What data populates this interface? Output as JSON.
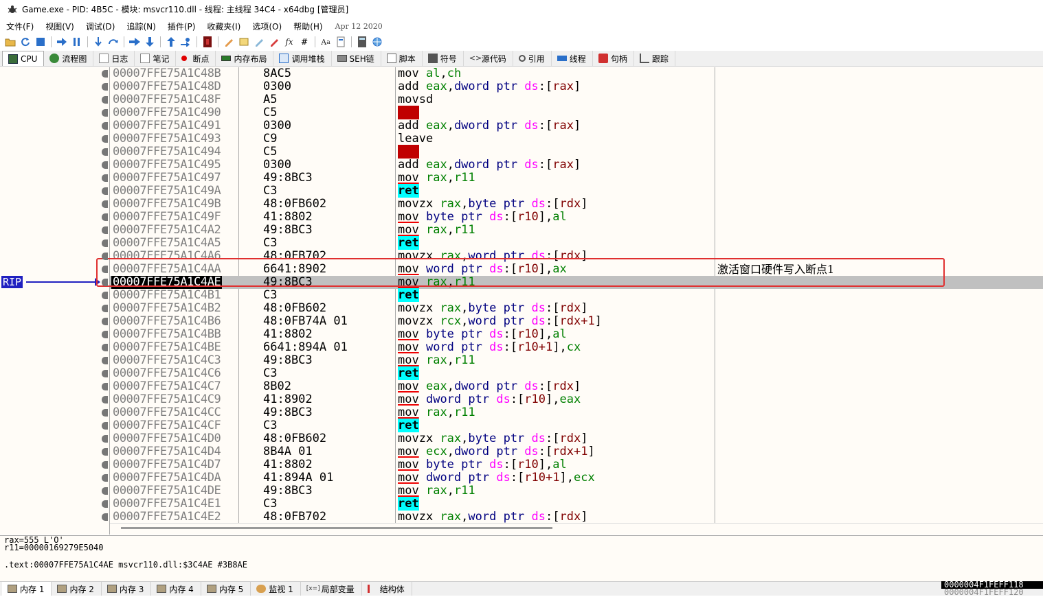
{
  "title": "Game.exe - PID: 4B5C - 模块: msvcr110.dll - 线程: 主线程 34C4 - x64dbg [管理员]",
  "menu": {
    "items": [
      "文件(F)",
      "视图(V)",
      "调试(D)",
      "追踪(N)",
      "插件(P)",
      "收藏夹(I)",
      "选项(O)",
      "帮助(H)"
    ],
    "date": "Apr 12 2020"
  },
  "tabs": [
    {
      "label": "CPU",
      "icon": "cpu-icon"
    },
    {
      "label": "流程图",
      "icon": "graph-icon"
    },
    {
      "label": "日志",
      "icon": "log-icon"
    },
    {
      "label": "笔记",
      "icon": "notes-icon"
    },
    {
      "label": "断点",
      "icon": "breakpoint-icon"
    },
    {
      "label": "内存布局",
      "icon": "memory-map-icon"
    },
    {
      "label": "调用堆栈",
      "icon": "call-stack-icon"
    },
    {
      "label": "SEH链",
      "icon": "seh-icon"
    },
    {
      "label": "脚本",
      "icon": "script-icon"
    },
    {
      "label": "符号",
      "icon": "symbol-icon"
    },
    {
      "label": "源代码",
      "icon": "source-icon"
    },
    {
      "label": "引用",
      "icon": "references-icon"
    },
    {
      "label": "线程",
      "icon": "threads-icon"
    },
    {
      "label": "句柄",
      "icon": "handles-icon"
    },
    {
      "label": "跟踪",
      "icon": "trace-icon"
    }
  ],
  "rip_label": "RIP",
  "disasm": [
    {
      "addr": "00007FFE75A1C48B",
      "bytes": "8AC5",
      "tokens": [
        [
          "mn",
          "mov"
        ],
        [
          "t",
          " "
        ],
        [
          "reg",
          "al"
        ],
        [
          "br",
          ","
        ],
        [
          "reg",
          "ch"
        ]
      ]
    },
    {
      "addr": "00007FFE75A1C48D",
      "bytes": "0300",
      "tokens": [
        [
          "mn",
          "add"
        ],
        [
          "t",
          " "
        ],
        [
          "reg",
          "eax"
        ],
        [
          "br",
          ","
        ],
        [
          "sz",
          "dword ptr "
        ],
        [
          "seg",
          "ds"
        ],
        [
          "br",
          ":["
        ],
        [
          "num",
          "rax"
        ],
        [
          "br",
          "]"
        ]
      ]
    },
    {
      "addr": "00007FFE75A1C48F",
      "bytes": "A5",
      "tokens": [
        [
          "mn",
          "movsd"
        ]
      ]
    },
    {
      "addr": "00007FFE75A1C490",
      "bytes": "C5",
      "tokens": [
        [
          "bad",
          "???"
        ]
      ]
    },
    {
      "addr": "00007FFE75A1C491",
      "bytes": "0300",
      "tokens": [
        [
          "mn",
          "add"
        ],
        [
          "t",
          " "
        ],
        [
          "reg",
          "eax"
        ],
        [
          "br",
          ","
        ],
        [
          "sz",
          "dword ptr "
        ],
        [
          "seg",
          "ds"
        ],
        [
          "br",
          ":["
        ],
        [
          "num",
          "rax"
        ],
        [
          "br",
          "]"
        ]
      ]
    },
    {
      "addr": "00007FFE75A1C493",
      "bytes": "C9",
      "tokens": [
        [
          "mn",
          "leave"
        ]
      ]
    },
    {
      "addr": "00007FFE75A1C494",
      "bytes": "C5",
      "tokens": [
        [
          "bad",
          "???"
        ]
      ]
    },
    {
      "addr": "00007FFE75A1C495",
      "bytes": "0300",
      "tokens": [
        [
          "mn",
          "add"
        ],
        [
          "t",
          " "
        ],
        [
          "reg",
          "eax"
        ],
        [
          "br",
          ","
        ],
        [
          "sz",
          "dword ptr "
        ],
        [
          "seg",
          "ds"
        ],
        [
          "br",
          ":["
        ],
        [
          "num",
          "rax"
        ],
        [
          "br",
          "]"
        ]
      ]
    },
    {
      "addr": "00007FFE75A1C497",
      "bytes": "49:8BC3",
      "tokens": [
        [
          "mnu",
          "mov"
        ],
        [
          "t",
          " "
        ],
        [
          "reg",
          "rax"
        ],
        [
          "br",
          ","
        ],
        [
          "reg",
          "r11"
        ]
      ]
    },
    {
      "addr": "00007FFE75A1C49A",
      "bytes": "C3",
      "tokens": [
        [
          "ret",
          "ret"
        ]
      ]
    },
    {
      "addr": "00007FFE75A1C49B",
      "bytes": "48:0FB602",
      "tokens": [
        [
          "mn",
          "movzx"
        ],
        [
          "t",
          " "
        ],
        [
          "reg",
          "rax"
        ],
        [
          "br",
          ","
        ],
        [
          "sz",
          "byte ptr "
        ],
        [
          "seg",
          "ds"
        ],
        [
          "br",
          ":["
        ],
        [
          "num",
          "rdx"
        ],
        [
          "br",
          "]"
        ]
      ]
    },
    {
      "addr": "00007FFE75A1C49F",
      "bytes": "41:8802",
      "tokens": [
        [
          "mnu",
          "mov"
        ],
        [
          "t",
          " "
        ],
        [
          "sz",
          "byte ptr "
        ],
        [
          "seg",
          "ds"
        ],
        [
          "br",
          ":["
        ],
        [
          "num",
          "r10"
        ],
        [
          "br",
          "]"
        ],
        [
          "br",
          ","
        ],
        [
          "reg",
          "al"
        ]
      ]
    },
    {
      "addr": "00007FFE75A1C4A2",
      "bytes": "49:8BC3",
      "tokens": [
        [
          "mnu",
          "mov"
        ],
        [
          "t",
          " "
        ],
        [
          "reg",
          "rax"
        ],
        [
          "br",
          ","
        ],
        [
          "reg",
          "r11"
        ]
      ]
    },
    {
      "addr": "00007FFE75A1C4A5",
      "bytes": "C3",
      "tokens": [
        [
          "ret",
          "ret"
        ]
      ]
    },
    {
      "addr": "00007FFE75A1C4A6",
      "bytes": "48:0FB702",
      "tokens": [
        [
          "mn",
          "movzx"
        ],
        [
          "t",
          " "
        ],
        [
          "reg",
          "rax"
        ],
        [
          "br",
          ","
        ],
        [
          "sz",
          "word ptr "
        ],
        [
          "seg",
          "ds"
        ],
        [
          "br",
          ":["
        ],
        [
          "num",
          "rdx"
        ],
        [
          "br",
          "]"
        ]
      ]
    },
    {
      "addr": "00007FFE75A1C4AA",
      "bytes": "6641:8902",
      "tokens": [
        [
          "mnu",
          "mov"
        ],
        [
          "t",
          " "
        ],
        [
          "sz",
          "word ptr "
        ],
        [
          "seg",
          "ds"
        ],
        [
          "br",
          ":["
        ],
        [
          "num",
          "r10"
        ],
        [
          "br",
          "]"
        ],
        [
          "br",
          ","
        ],
        [
          "reg",
          "ax"
        ]
      ],
      "comment": "激活窗口硬件写入断点1"
    },
    {
      "addr": "00007FFE75A1C4AE",
      "bytes": "49:8BC3",
      "tokens": [
        [
          "mnu",
          "mov"
        ],
        [
          "t",
          " "
        ],
        [
          "reg",
          "rax"
        ],
        [
          "br",
          ","
        ],
        [
          "reg",
          "r11"
        ]
      ],
      "selected": true
    },
    {
      "addr": "00007FFE75A1C4B1",
      "bytes": "C3",
      "tokens": [
        [
          "ret",
          "ret"
        ]
      ]
    },
    {
      "addr": "00007FFE75A1C4B2",
      "bytes": "48:0FB602",
      "tokens": [
        [
          "mn",
          "movzx"
        ],
        [
          "t",
          " "
        ],
        [
          "reg",
          "rax"
        ],
        [
          "br",
          ","
        ],
        [
          "sz",
          "byte ptr "
        ],
        [
          "seg",
          "ds"
        ],
        [
          "br",
          ":["
        ],
        [
          "num",
          "rdx"
        ],
        [
          "br",
          "]"
        ]
      ]
    },
    {
      "addr": "00007FFE75A1C4B6",
      "bytes": "48:0FB74A 01",
      "tokens": [
        [
          "mn",
          "movzx"
        ],
        [
          "t",
          " "
        ],
        [
          "reg",
          "rcx"
        ],
        [
          "br",
          ","
        ],
        [
          "sz",
          "word ptr "
        ],
        [
          "seg",
          "ds"
        ],
        [
          "br",
          ":["
        ],
        [
          "num",
          "rdx"
        ],
        [
          "plus",
          "+1"
        ],
        [
          "br",
          "]"
        ]
      ]
    },
    {
      "addr": "00007FFE75A1C4BB",
      "bytes": "41:8802",
      "tokens": [
        [
          "mnu",
          "mov"
        ],
        [
          "t",
          " "
        ],
        [
          "sz",
          "byte ptr "
        ],
        [
          "seg",
          "ds"
        ],
        [
          "br",
          ":["
        ],
        [
          "num",
          "r10"
        ],
        [
          "br",
          "]"
        ],
        [
          "br",
          ","
        ],
        [
          "reg",
          "al"
        ]
      ]
    },
    {
      "addr": "00007FFE75A1C4BE",
      "bytes": "6641:894A 01",
      "tokens": [
        [
          "mnu",
          "mov"
        ],
        [
          "t",
          " "
        ],
        [
          "sz",
          "word ptr "
        ],
        [
          "seg",
          "ds"
        ],
        [
          "br",
          ":["
        ],
        [
          "num",
          "r10"
        ],
        [
          "plus",
          "+1"
        ],
        [
          "br",
          "]"
        ],
        [
          "br",
          ","
        ],
        [
          "reg",
          "cx"
        ]
      ]
    },
    {
      "addr": "00007FFE75A1C4C3",
      "bytes": "49:8BC3",
      "tokens": [
        [
          "mnu",
          "mov"
        ],
        [
          "t",
          " "
        ],
        [
          "reg",
          "rax"
        ],
        [
          "br",
          ","
        ],
        [
          "reg",
          "r11"
        ]
      ]
    },
    {
      "addr": "00007FFE75A1C4C6",
      "bytes": "C3",
      "tokens": [
        [
          "ret",
          "ret"
        ]
      ]
    },
    {
      "addr": "00007FFE75A1C4C7",
      "bytes": "8B02",
      "tokens": [
        [
          "mnu",
          "mov"
        ],
        [
          "t",
          " "
        ],
        [
          "reg",
          "eax"
        ],
        [
          "br",
          ","
        ],
        [
          "sz",
          "dword ptr "
        ],
        [
          "seg",
          "ds"
        ],
        [
          "br",
          ":["
        ],
        [
          "num",
          "rdx"
        ],
        [
          "br",
          "]"
        ]
      ]
    },
    {
      "addr": "00007FFE75A1C4C9",
      "bytes": "41:8902",
      "tokens": [
        [
          "mnu",
          "mov"
        ],
        [
          "t",
          " "
        ],
        [
          "sz",
          "dword ptr "
        ],
        [
          "seg",
          "ds"
        ],
        [
          "br",
          ":["
        ],
        [
          "num",
          "r10"
        ],
        [
          "br",
          "]"
        ],
        [
          "br",
          ","
        ],
        [
          "reg",
          "eax"
        ]
      ]
    },
    {
      "addr": "00007FFE75A1C4CC",
      "bytes": "49:8BC3",
      "tokens": [
        [
          "mnu",
          "mov"
        ],
        [
          "t",
          " "
        ],
        [
          "reg",
          "rax"
        ],
        [
          "br",
          ","
        ],
        [
          "reg",
          "r11"
        ]
      ]
    },
    {
      "addr": "00007FFE75A1C4CF",
      "bytes": "C3",
      "tokens": [
        [
          "ret",
          "ret"
        ]
      ]
    },
    {
      "addr": "00007FFE75A1C4D0",
      "bytes": "48:0FB602",
      "tokens": [
        [
          "mn",
          "movzx"
        ],
        [
          "t",
          " "
        ],
        [
          "reg",
          "rax"
        ],
        [
          "br",
          ","
        ],
        [
          "sz",
          "byte ptr "
        ],
        [
          "seg",
          "ds"
        ],
        [
          "br",
          ":["
        ],
        [
          "num",
          "rdx"
        ],
        [
          "br",
          "]"
        ]
      ]
    },
    {
      "addr": "00007FFE75A1C4D4",
      "bytes": "8B4A 01",
      "tokens": [
        [
          "mnu",
          "mov"
        ],
        [
          "t",
          " "
        ],
        [
          "reg",
          "ecx"
        ],
        [
          "br",
          ","
        ],
        [
          "sz",
          "dword ptr "
        ],
        [
          "seg",
          "ds"
        ],
        [
          "br",
          ":["
        ],
        [
          "num",
          "rdx"
        ],
        [
          "plus",
          "+1"
        ],
        [
          "br",
          "]"
        ]
      ]
    },
    {
      "addr": "00007FFE75A1C4D7",
      "bytes": "41:8802",
      "tokens": [
        [
          "mnu",
          "mov"
        ],
        [
          "t",
          " "
        ],
        [
          "sz",
          "byte ptr "
        ],
        [
          "seg",
          "ds"
        ],
        [
          "br",
          ":["
        ],
        [
          "num",
          "r10"
        ],
        [
          "br",
          "]"
        ],
        [
          "br",
          ","
        ],
        [
          "reg",
          "al"
        ]
      ]
    },
    {
      "addr": "00007FFE75A1C4DA",
      "bytes": "41:894A 01",
      "tokens": [
        [
          "mnu",
          "mov"
        ],
        [
          "t",
          " "
        ],
        [
          "sz",
          "dword ptr "
        ],
        [
          "seg",
          "ds"
        ],
        [
          "br",
          ":["
        ],
        [
          "num",
          "r10"
        ],
        [
          "plus",
          "+1"
        ],
        [
          "br",
          "]"
        ],
        [
          "br",
          ","
        ],
        [
          "reg",
          "ecx"
        ]
      ]
    },
    {
      "addr": "00007FFE75A1C4DE",
      "bytes": "49:8BC3",
      "tokens": [
        [
          "mnu",
          "mov"
        ],
        [
          "t",
          " "
        ],
        [
          "reg",
          "rax"
        ],
        [
          "br",
          ","
        ],
        [
          "reg",
          "r11"
        ]
      ]
    },
    {
      "addr": "00007FFE75A1C4E1",
      "bytes": "C3",
      "tokens": [
        [
          "ret",
          "ret"
        ]
      ]
    },
    {
      "addr": "00007FFE75A1C4E2",
      "bytes": "48:0FB702",
      "tokens": [
        [
          "mn",
          "movzx"
        ],
        [
          "t",
          " "
        ],
        [
          "reg",
          "rax"
        ],
        [
          "br",
          ","
        ],
        [
          "sz",
          "word ptr "
        ],
        [
          "seg",
          "ds"
        ],
        [
          "br",
          ":["
        ],
        [
          "num",
          "rdx"
        ],
        [
          "br",
          "]"
        ]
      ]
    }
  ],
  "info": {
    "line1": "rax=555 L'O'",
    "line2": "r11=00000169279E5040",
    "line3": ".text:00007FFE75A1C4AE msvcr110.dll:$3C4AE #3B8AE"
  },
  "bottom_tabs": [
    {
      "label": "内存 1",
      "icon": "dump-icon"
    },
    {
      "label": "内存 2",
      "icon": "dump-icon"
    },
    {
      "label": "内存 3",
      "icon": "dump-icon"
    },
    {
      "label": "内存 4",
      "icon": "dump-icon"
    },
    {
      "label": "内存 5",
      "icon": "dump-icon"
    },
    {
      "label": "监视 1",
      "icon": "watch-icon"
    },
    {
      "label": "局部变量",
      "icon": "locals-icon"
    },
    {
      "label": "结构体",
      "icon": "struct-icon"
    }
  ],
  "stack": {
    "addr1": "0000004F1FEFF118",
    "addr2": "0000004F1FEFF120"
  },
  "colors": {
    "register": "#008000",
    "segment": "#ff00ff",
    "memory_operand": "#800000",
    "ret_highlight": "#00ffff",
    "invalid": "#c00000",
    "rip": "#2020c0",
    "annotation_box": "#e03030"
  }
}
